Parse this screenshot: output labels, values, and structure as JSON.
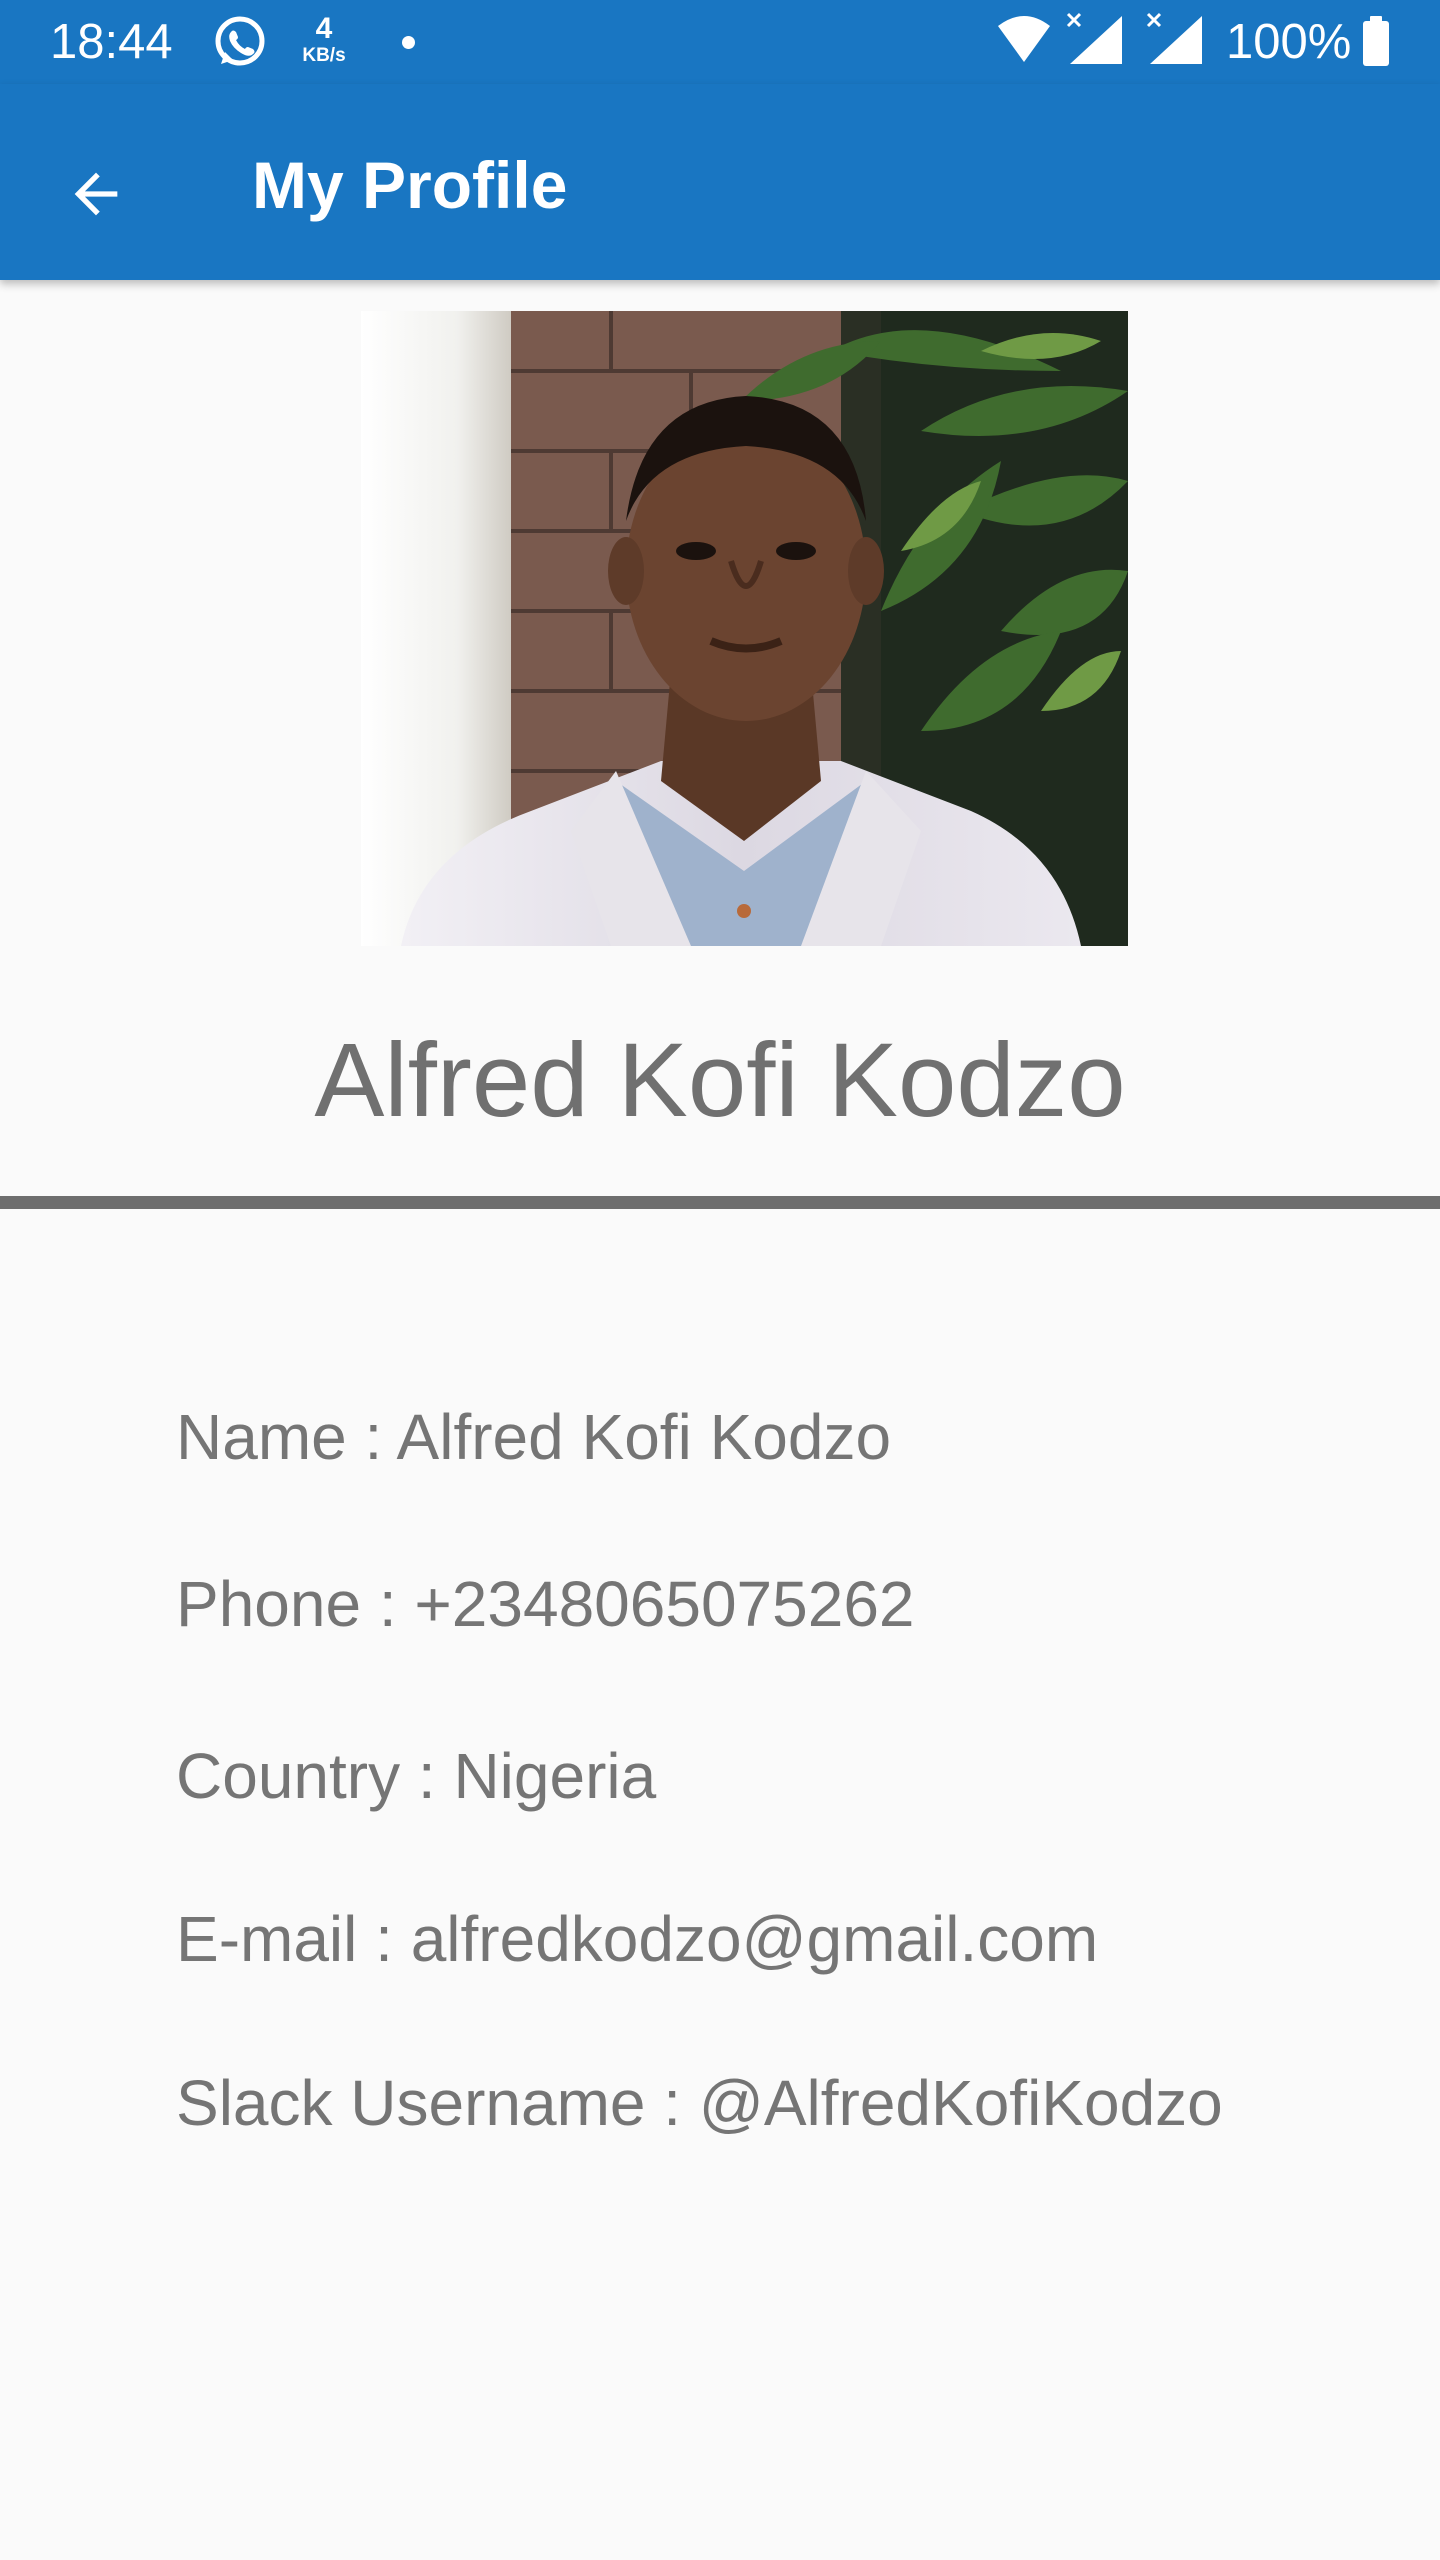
{
  "status_bar": {
    "time": "18:44",
    "net_speed_value": "4",
    "net_speed_unit": "KB/s",
    "battery": "100%",
    "icons": [
      "whatsapp-icon",
      "wifi-icon",
      "cell-signal-icon",
      "cell-signal-icon",
      "battery-icon"
    ]
  },
  "app_bar": {
    "title": "My Profile",
    "back_icon": "arrow-left-icon"
  },
  "profile": {
    "display_name": "Alfred Kofi Kodzo",
    "photo": "profile-photo"
  },
  "details": {
    "name": "Name : Alfred Kofi Kodzo",
    "phone": "Phone : +2348065075262",
    "country": "Country : Nigeria",
    "email": "E-mail : alfredkodzo@gmail.com",
    "slack": "Slack Username : @AlfredKofiKodzo"
  },
  "colors": {
    "primary": "#1976c2",
    "background": "#fafafa",
    "text": "#757575",
    "divider": "#6e6e6e"
  }
}
